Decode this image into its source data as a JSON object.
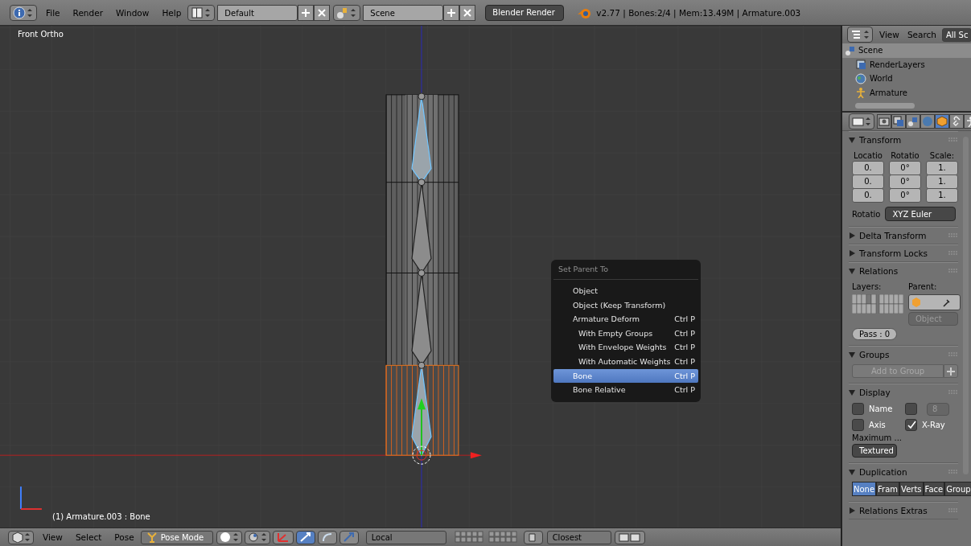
{
  "top_bar": {
    "menus": [
      "File",
      "Render",
      "Window",
      "Help"
    ],
    "screen_layout": "Default",
    "scene": "Scene",
    "render_engine": "Blender Render",
    "stats": "v2.77 | Bones:2/4  | Mem:13.49M | Armature.003"
  },
  "viewport": {
    "view_name": "Front Ortho",
    "object_info": "(1) Armature.003 : Bone",
    "context_menu": {
      "title": "Set Parent To",
      "items": [
        {
          "label": "Object",
          "selected": false
        },
        {
          "label": "Object (Keep Transform)",
          "selected": false
        },
        {
          "label": "Armature Deform",
          "shortcut": "Ctrl P",
          "selected": false,
          "children": [
            {
              "label": "With Empty Groups",
              "shortcut": "Ctrl P",
              "selected": false
            },
            {
              "label": "With Envelope Weights",
              "shortcut": "Ctrl P",
              "selected": false
            },
            {
              "label": "With Automatic Weights",
              "shortcut": "Ctrl P",
              "selected": false
            }
          ]
        },
        {
          "label": "Bone",
          "shortcut": "Ctrl P",
          "selected": true
        },
        {
          "label": "Bone Relative",
          "shortcut": "Ctrl P",
          "selected": false
        }
      ]
    }
  },
  "viewport_header": {
    "menus": [
      "View",
      "Select",
      "Pose"
    ],
    "mode": "Pose Mode",
    "transform_orientation": "Local",
    "snap_target": "Closest"
  },
  "outliner": {
    "header_menus": [
      "View",
      "Search"
    ],
    "display_filter": "All Sc",
    "items": [
      {
        "label": "Scene",
        "kind": "scene",
        "selected": true,
        "children": [
          {
            "label": "RenderLayers",
            "kind": "render_layers",
            "selected": false
          },
          {
            "label": "World",
            "kind": "world",
            "selected": false
          },
          {
            "label": "Armature",
            "kind": "armature",
            "selected": false
          }
        ]
      }
    ]
  },
  "properties": {
    "tabs": [
      {
        "kind": "render",
        "selected": false
      },
      {
        "kind": "render_layers",
        "selected": false
      },
      {
        "kind": "scene",
        "selected": false
      },
      {
        "kind": "world",
        "selected": false
      },
      {
        "kind": "object",
        "selected": true
      },
      {
        "kind": "constraints",
        "selected": false
      },
      {
        "kind": "armature",
        "selected": false
      }
    ],
    "panels": [
      {
        "kind": "transform",
        "title": "Transform",
        "expanded": true,
        "columns": [
          {
            "label": "Locatio",
            "values": [
              "0.",
              "0.",
              "0."
            ]
          },
          {
            "label": "Rotatio",
            "values": [
              "0°",
              "0°",
              "0°"
            ]
          },
          {
            "label": "Scale:",
            "values": [
              "1.",
              "1.",
              "1."
            ]
          }
        ],
        "rotation_mode_label": "Rotatio",
        "rotation_mode": "XYZ Euler"
      },
      {
        "kind": "delta_transform",
        "title": "Delta Transform",
        "expanded": false
      },
      {
        "kind": "transform_locks",
        "title": "Transform Locks",
        "expanded": false
      },
      {
        "kind": "relations",
        "title": "Relations",
        "expanded": true,
        "layers_label": "Layers:",
        "parent_label": "Parent:",
        "parent_type": "Object",
        "pass_index": "Pass : 0"
      },
      {
        "kind": "groups",
        "title": "Groups",
        "expanded": true,
        "button": "Add to Group"
      },
      {
        "kind": "display",
        "title": "Display",
        "expanded": true,
        "options": [
          {
            "label": "Name",
            "checked": false
          },
          {
            "kind": "bounds",
            "checked": false,
            "value": "8"
          },
          {
            "label": "Axis",
            "checked": false
          },
          {
            "label": "X-Ray",
            "checked": true
          }
        ],
        "max_draw_label": "Maximum ...",
        "max_draw_type": "Textured"
      },
      {
        "kind": "duplication",
        "title": "Duplication",
        "expanded": true,
        "options": [
          {
            "label": "None",
            "selected": true
          },
          {
            "label": "Fram",
            "selected": false
          },
          {
            "label": "Verts",
            "selected": false
          },
          {
            "label": "Face",
            "selected": false
          },
          {
            "label": "Group",
            "selected": false
          }
        ]
      },
      {
        "kind": "relations_extras",
        "title": "Relations Extras",
        "expanded": false
      }
    ]
  }
}
